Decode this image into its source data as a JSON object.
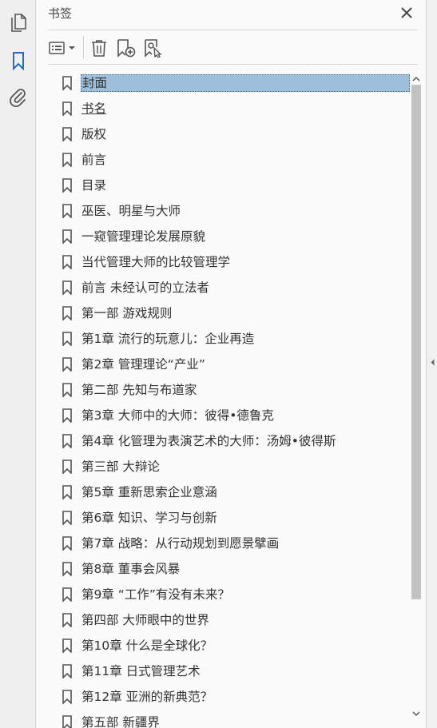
{
  "left_rail": {
    "items": [
      {
        "name": "page-thumbnails",
        "icon": "pages-icon"
      },
      {
        "name": "bookmarks",
        "icon": "bookmark-icon",
        "active": true
      },
      {
        "name": "attachments",
        "icon": "paperclip-icon"
      }
    ]
  },
  "panel": {
    "title": "书签",
    "close_icon": "close-icon"
  },
  "toolbar": {
    "options_icon": "options-menu-icon",
    "delete_icon": "trash-icon",
    "new_bookmark_icon": "new-bookmark-icon",
    "find_bookmark_icon": "find-bookmark-icon"
  },
  "bookmarks": [
    {
      "label": "封面",
      "selected": true
    },
    {
      "label": "书名",
      "linked": true
    },
    {
      "label": "版权"
    },
    {
      "label": "前言"
    },
    {
      "label": "目录"
    },
    {
      "label": "巫医、明星与大师"
    },
    {
      "label": "一窥管理理论发展原貌"
    },
    {
      "label": "当代管理大师的比较管理学"
    },
    {
      "label": "前言 未经认可的立法者"
    },
    {
      "label": "第一部 游戏规则"
    },
    {
      "label": "第1章 流行的玩意儿：企业再造"
    },
    {
      "label": "第2章 管理理论“产业”"
    },
    {
      "label": "第二部 先知与布道家"
    },
    {
      "label": "第3章 大师中的大师：彼得•德鲁克"
    },
    {
      "label": "第4章 化管理为表演艺术的大师：汤姆•彼得斯"
    },
    {
      "label": "第三部 大辩论"
    },
    {
      "label": "第5章 重新思索企业意涵"
    },
    {
      "label": "第6章 知识、学习与创新"
    },
    {
      "label": "第7章 战略：从行动规划到愿景擘画"
    },
    {
      "label": "第8章 董事会风暴"
    },
    {
      "label": "第9章 “工作”有没有未来？"
    },
    {
      "label": "第四部 大师眼中的世界"
    },
    {
      "label": "第10章 什么是全球化？"
    },
    {
      "label": "第11章 日式管理艺术"
    },
    {
      "label": "第12章 亚洲的新典范？"
    },
    {
      "label": "第五部 新疆界"
    }
  ],
  "colors": {
    "accent": "#2a6ebb",
    "selection": "#9dbfd9",
    "icon_gray": "#555555"
  }
}
